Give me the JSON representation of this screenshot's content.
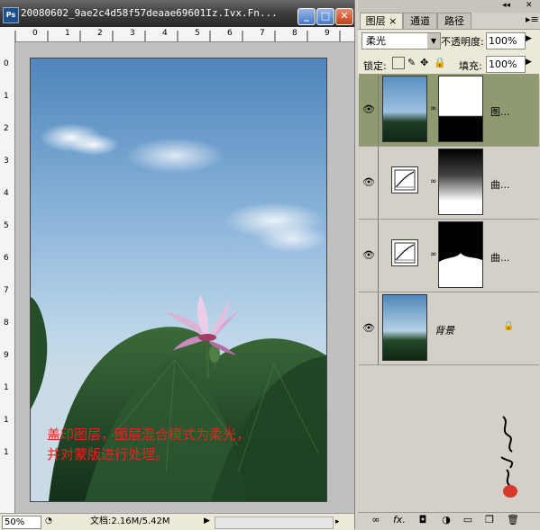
{
  "window": {
    "title": "20080602_9ae2c4d58f57deaae69601Iz.Ivx.Fn...",
    "minimize": "_",
    "maximize": "□",
    "close": "✕"
  },
  "ruler": {
    "top_numbers": [
      "0",
      "1",
      "2",
      "3",
      "4",
      "5",
      "6",
      "7",
      "8",
      "9"
    ],
    "left_numbers": [
      "0",
      "1",
      "2",
      "3",
      "4",
      "5",
      "6",
      "7",
      "8",
      "9",
      "1",
      "1",
      "1"
    ]
  },
  "caption": {
    "line1": "盖印图层，图层混合模式为柔光，",
    "line2": "并对蒙版进行处理。"
  },
  "status": {
    "zoom": "50%",
    "doc_info": "文档:2.16M/5.42M"
  },
  "panel": {
    "tabs": [
      "图层 ×",
      "通道",
      "路径"
    ],
    "blend_mode": "柔光",
    "opacity_label": "不透明度:",
    "opacity_value": "100%",
    "lock_label": "锁定:",
    "fill_label": "填充:",
    "fill_value": "100%",
    "layers": [
      {
        "name": "图...",
        "active": true
      },
      {
        "name": "曲..."
      },
      {
        "name": "曲..."
      },
      {
        "name": "背景"
      }
    ],
    "bottom_icons": [
      "link-icon",
      "fx-icon",
      "mask-icon",
      "adjustment-icon",
      "group-icon",
      "new-layer-icon",
      "trash-icon"
    ]
  }
}
